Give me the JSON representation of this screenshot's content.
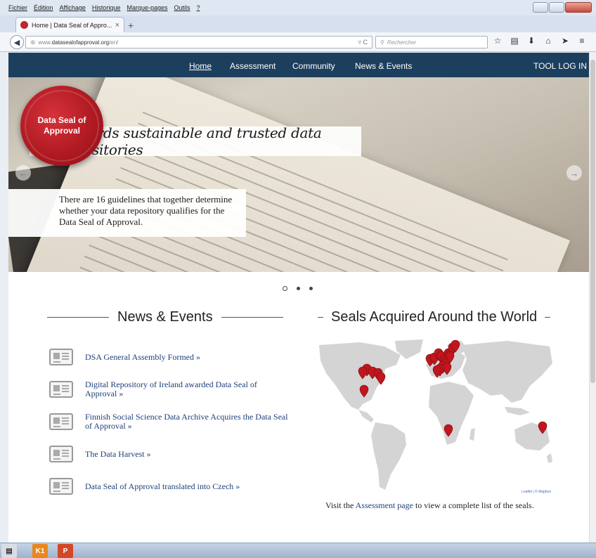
{
  "browser": {
    "menu": [
      "Fichier",
      "Édition",
      "Affichage",
      "Historique",
      "Marque-pages",
      "Outils",
      "?"
    ],
    "tab_title": "Home | Data Seal of Appro...",
    "url_prefix": "www.",
    "url_domain": "datasealofapproval.org",
    "url_path": "/en/",
    "search_placeholder": "Rechercher"
  },
  "site": {
    "nav": {
      "home": "Home",
      "assessment": "Assessment",
      "community": "Community",
      "news": "News & Events",
      "login": "TOOL LOG IN"
    },
    "seal_text": "Data Seal of Approval",
    "hero_tagline": "Towards sustainable and trusted data repositories",
    "hero_intro": "There are 16 guidelines that together determine whether your data repository qualifies for the Data Seal of Approval.",
    "carousel_slides": 3,
    "carousel_active": 1
  },
  "news_section": {
    "title": "News & Events",
    "items": [
      "DSA General Assembly Formed »",
      "Digital Repository of Ireland awarded Data Seal of Approval »",
      "Finnish Social Science Data Archive Acquires the Data Seal of Approval »",
      "The Data Harvest »",
      "Data Seal of Approval translated into Czech »"
    ]
  },
  "map_section": {
    "title": "Seals Acquired Around the World",
    "attribution": "Leaflet | © Mapbox",
    "caption_before": "Visit the ",
    "caption_link": "Assessment page",
    "caption_after": " to view a complete list of the seals.",
    "marker_color": "#c0161d"
  },
  "taskbar": [
    "K1",
    "P"
  ]
}
